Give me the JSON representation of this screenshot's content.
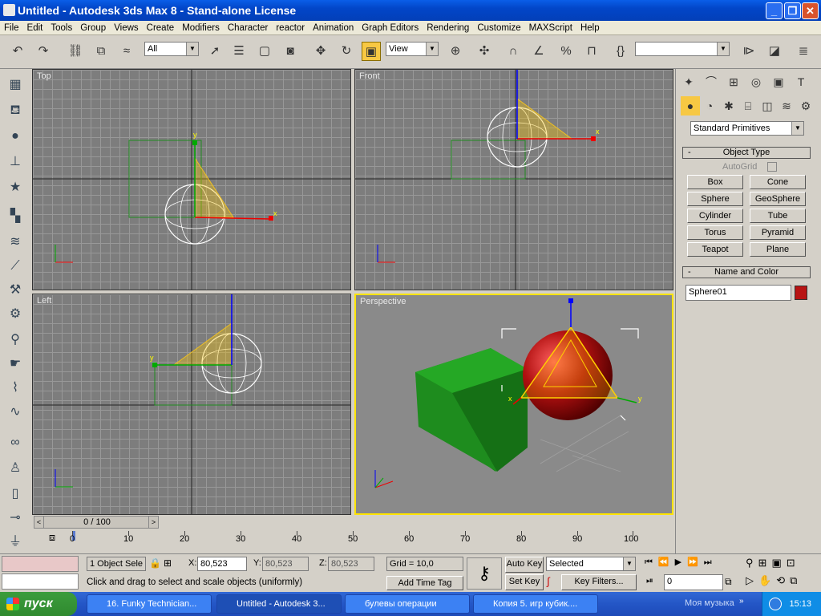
{
  "window": {
    "title": "Untitled - Autodesk 3ds Max 8   - Stand-alone License"
  },
  "menu": [
    "File",
    "Edit",
    "Tools",
    "Group",
    "Views",
    "Create",
    "Modifiers",
    "Character",
    "reactor",
    "Animation",
    "Graph Editors",
    "Rendering",
    "Customize",
    "MAXScript",
    "Help"
  ],
  "toolbar": {
    "selection_filter": "All",
    "ref_coord": "View",
    "named_selection": ""
  },
  "viewports": {
    "top": "Top",
    "front": "Front",
    "left": "Left",
    "perspective": "Perspective"
  },
  "command_panel": {
    "category": "Standard Primitives",
    "object_type_header": "Object Type",
    "autogrid_label": "AutoGrid",
    "buttons": [
      "Box",
      "Cone",
      "Sphere",
      "GeoSphere",
      "Cylinder",
      "Tube",
      "Torus",
      "Pyramid",
      "Teapot",
      "Plane"
    ],
    "name_color_header": "Name and Color",
    "object_name": "Sphere01",
    "object_color": "#b81414"
  },
  "timeline": {
    "frame": "0 / 100",
    "ticks": [
      "0",
      "10",
      "20",
      "30",
      "40",
      "50",
      "60",
      "70",
      "80",
      "90",
      "100"
    ]
  },
  "status": {
    "selection_count": "1 Object Sele",
    "x_label": "X:",
    "x_value": "80,523",
    "y_label": "Y:",
    "y_value": "80,523",
    "z_label": "Z:",
    "z_value": "80,523",
    "grid": "Grid = 10,0",
    "prompt": "Click and drag to select and scale objects (uniformly)",
    "add_time_tag": "Add Time Tag",
    "auto_key": "Auto Key",
    "set_key": "Set Key",
    "key_mode": "Selected",
    "key_filters": "Key Filters...",
    "current_frame": "0"
  },
  "taskbar": {
    "start": "пуск",
    "tasks": [
      "16. Funky Technician...",
      "Untitled - Autodesk 3...",
      "булевы операции",
      "Копия 5. игр кубик...."
    ],
    "music": "Моя музыка",
    "clock": "15:13"
  }
}
